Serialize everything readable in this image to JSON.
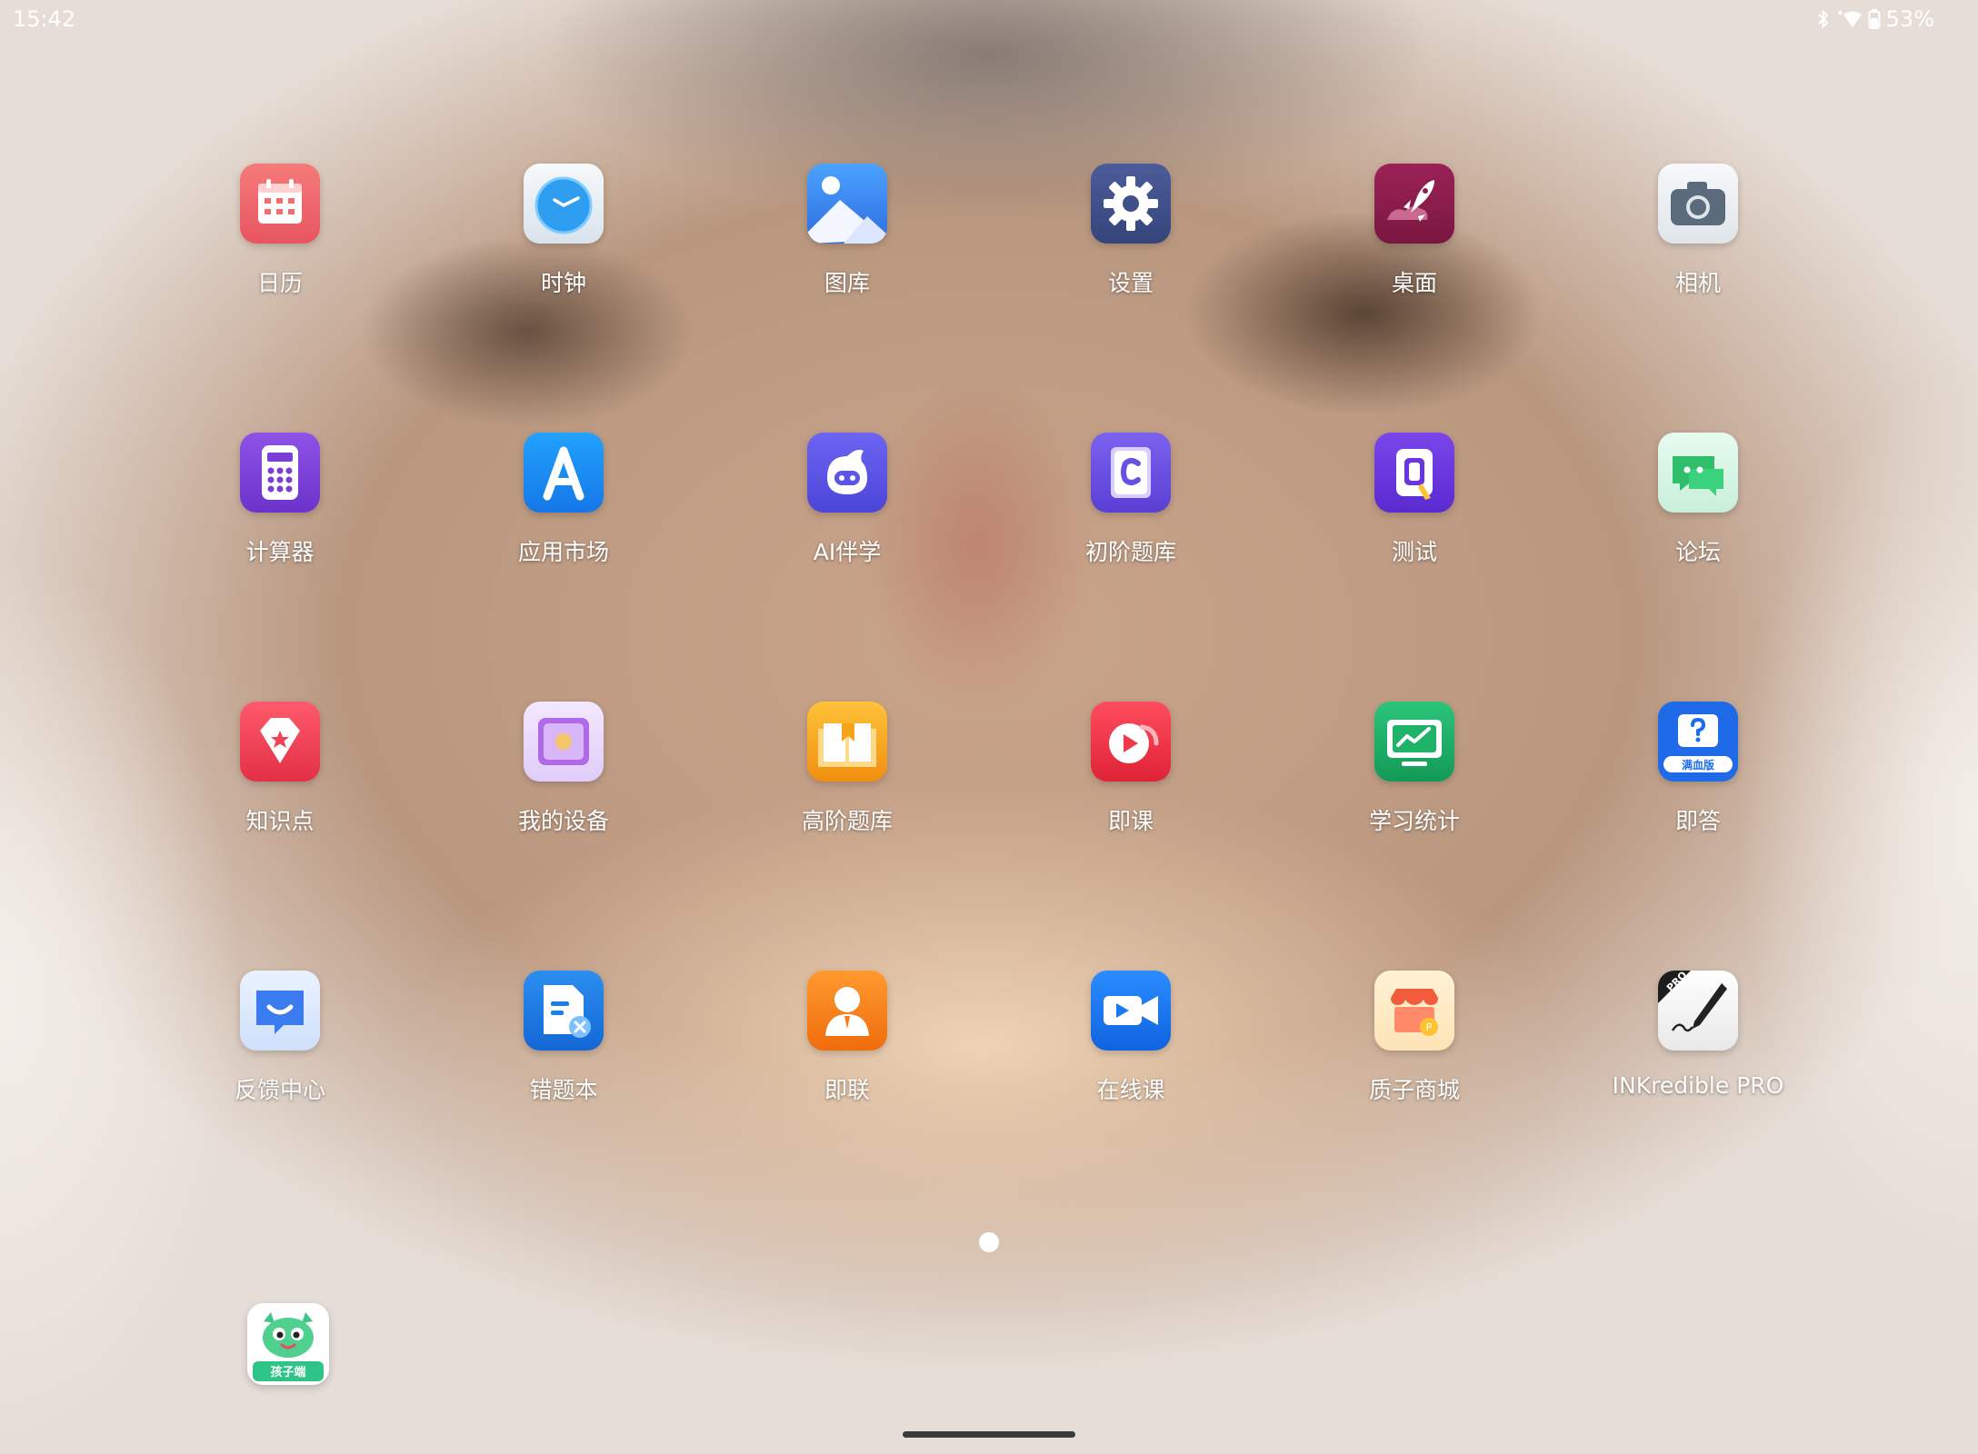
{
  "status": {
    "time": "15:42",
    "battery": "53%",
    "icons": [
      "bluetooth-icon",
      "wifi-icon",
      "battery-icon"
    ]
  },
  "apps": [
    {
      "label": "日历",
      "icon": "calendar-icon",
      "color": "#f0636b"
    },
    {
      "label": "时钟",
      "icon": "clock-icon",
      "color": "#2f9ef0"
    },
    {
      "label": "图库",
      "icon": "gallery-icon",
      "color": "#2f80ed"
    },
    {
      "label": "设置",
      "icon": "gear-icon",
      "color": "#3f4f8a"
    },
    {
      "label": "桌面",
      "icon": "rocket-icon",
      "color": "#8e1c4c"
    },
    {
      "label": "相机",
      "icon": "camera-icon",
      "color": "#5b6b7b"
    },
    {
      "label": "计算器",
      "icon": "calculator-icon",
      "color": "#7a3fd6"
    },
    {
      "label": "应用市场",
      "icon": "app-store-icon",
      "color": "#1a8ef3"
    },
    {
      "label": "AI伴学",
      "icon": "ai-mascot-icon",
      "color": "#5b55e8"
    },
    {
      "label": "初阶题库",
      "icon": "question-bank-c-icon",
      "color": "#6a4fe3"
    },
    {
      "label": "测试",
      "icon": "test-icon",
      "color": "#6a36e0"
    },
    {
      "label": "论坛",
      "icon": "forum-icon",
      "color": "#2fbf6b"
    },
    {
      "label": "知识点",
      "icon": "knowledge-point-icon",
      "color": "#f04156"
    },
    {
      "label": "我的设备",
      "icon": "my-device-icon",
      "color": "#b06ae8"
    },
    {
      "label": "高阶题库",
      "icon": "advanced-bank-icon",
      "color": "#f5a41a"
    },
    {
      "label": "即课",
      "icon": "play-lesson-icon",
      "color": "#f03a4b"
    },
    {
      "label": "学习统计",
      "icon": "study-stats-icon",
      "color": "#1fb36a"
    },
    {
      "label": "即答",
      "icon": "quick-answer-icon",
      "color": "#1a6ef0"
    },
    {
      "label": "反馈中心",
      "icon": "feedback-icon",
      "color": "#3a7bf0"
    },
    {
      "label": "错题本",
      "icon": "wrong-questions-icon",
      "color": "#1e7fe8"
    },
    {
      "label": "即联",
      "icon": "contact-icon",
      "color": "#f57a1a"
    },
    {
      "label": "在线课",
      "icon": "online-class-icon",
      "color": "#1a7af0"
    },
    {
      "label": "质子商城",
      "icon": "shop-icon",
      "color": "#f25c3c"
    },
    {
      "label": "INKredible PRO",
      "icon": "inkredible-pen-icon",
      "color": "#222222"
    }
  ],
  "badges": {
    "quick_answer": "满血版",
    "inkredible": "PRO"
  },
  "dock": {
    "icon": "kids-mascot-icon",
    "label": "孩子端",
    "color": "#2fc487"
  }
}
